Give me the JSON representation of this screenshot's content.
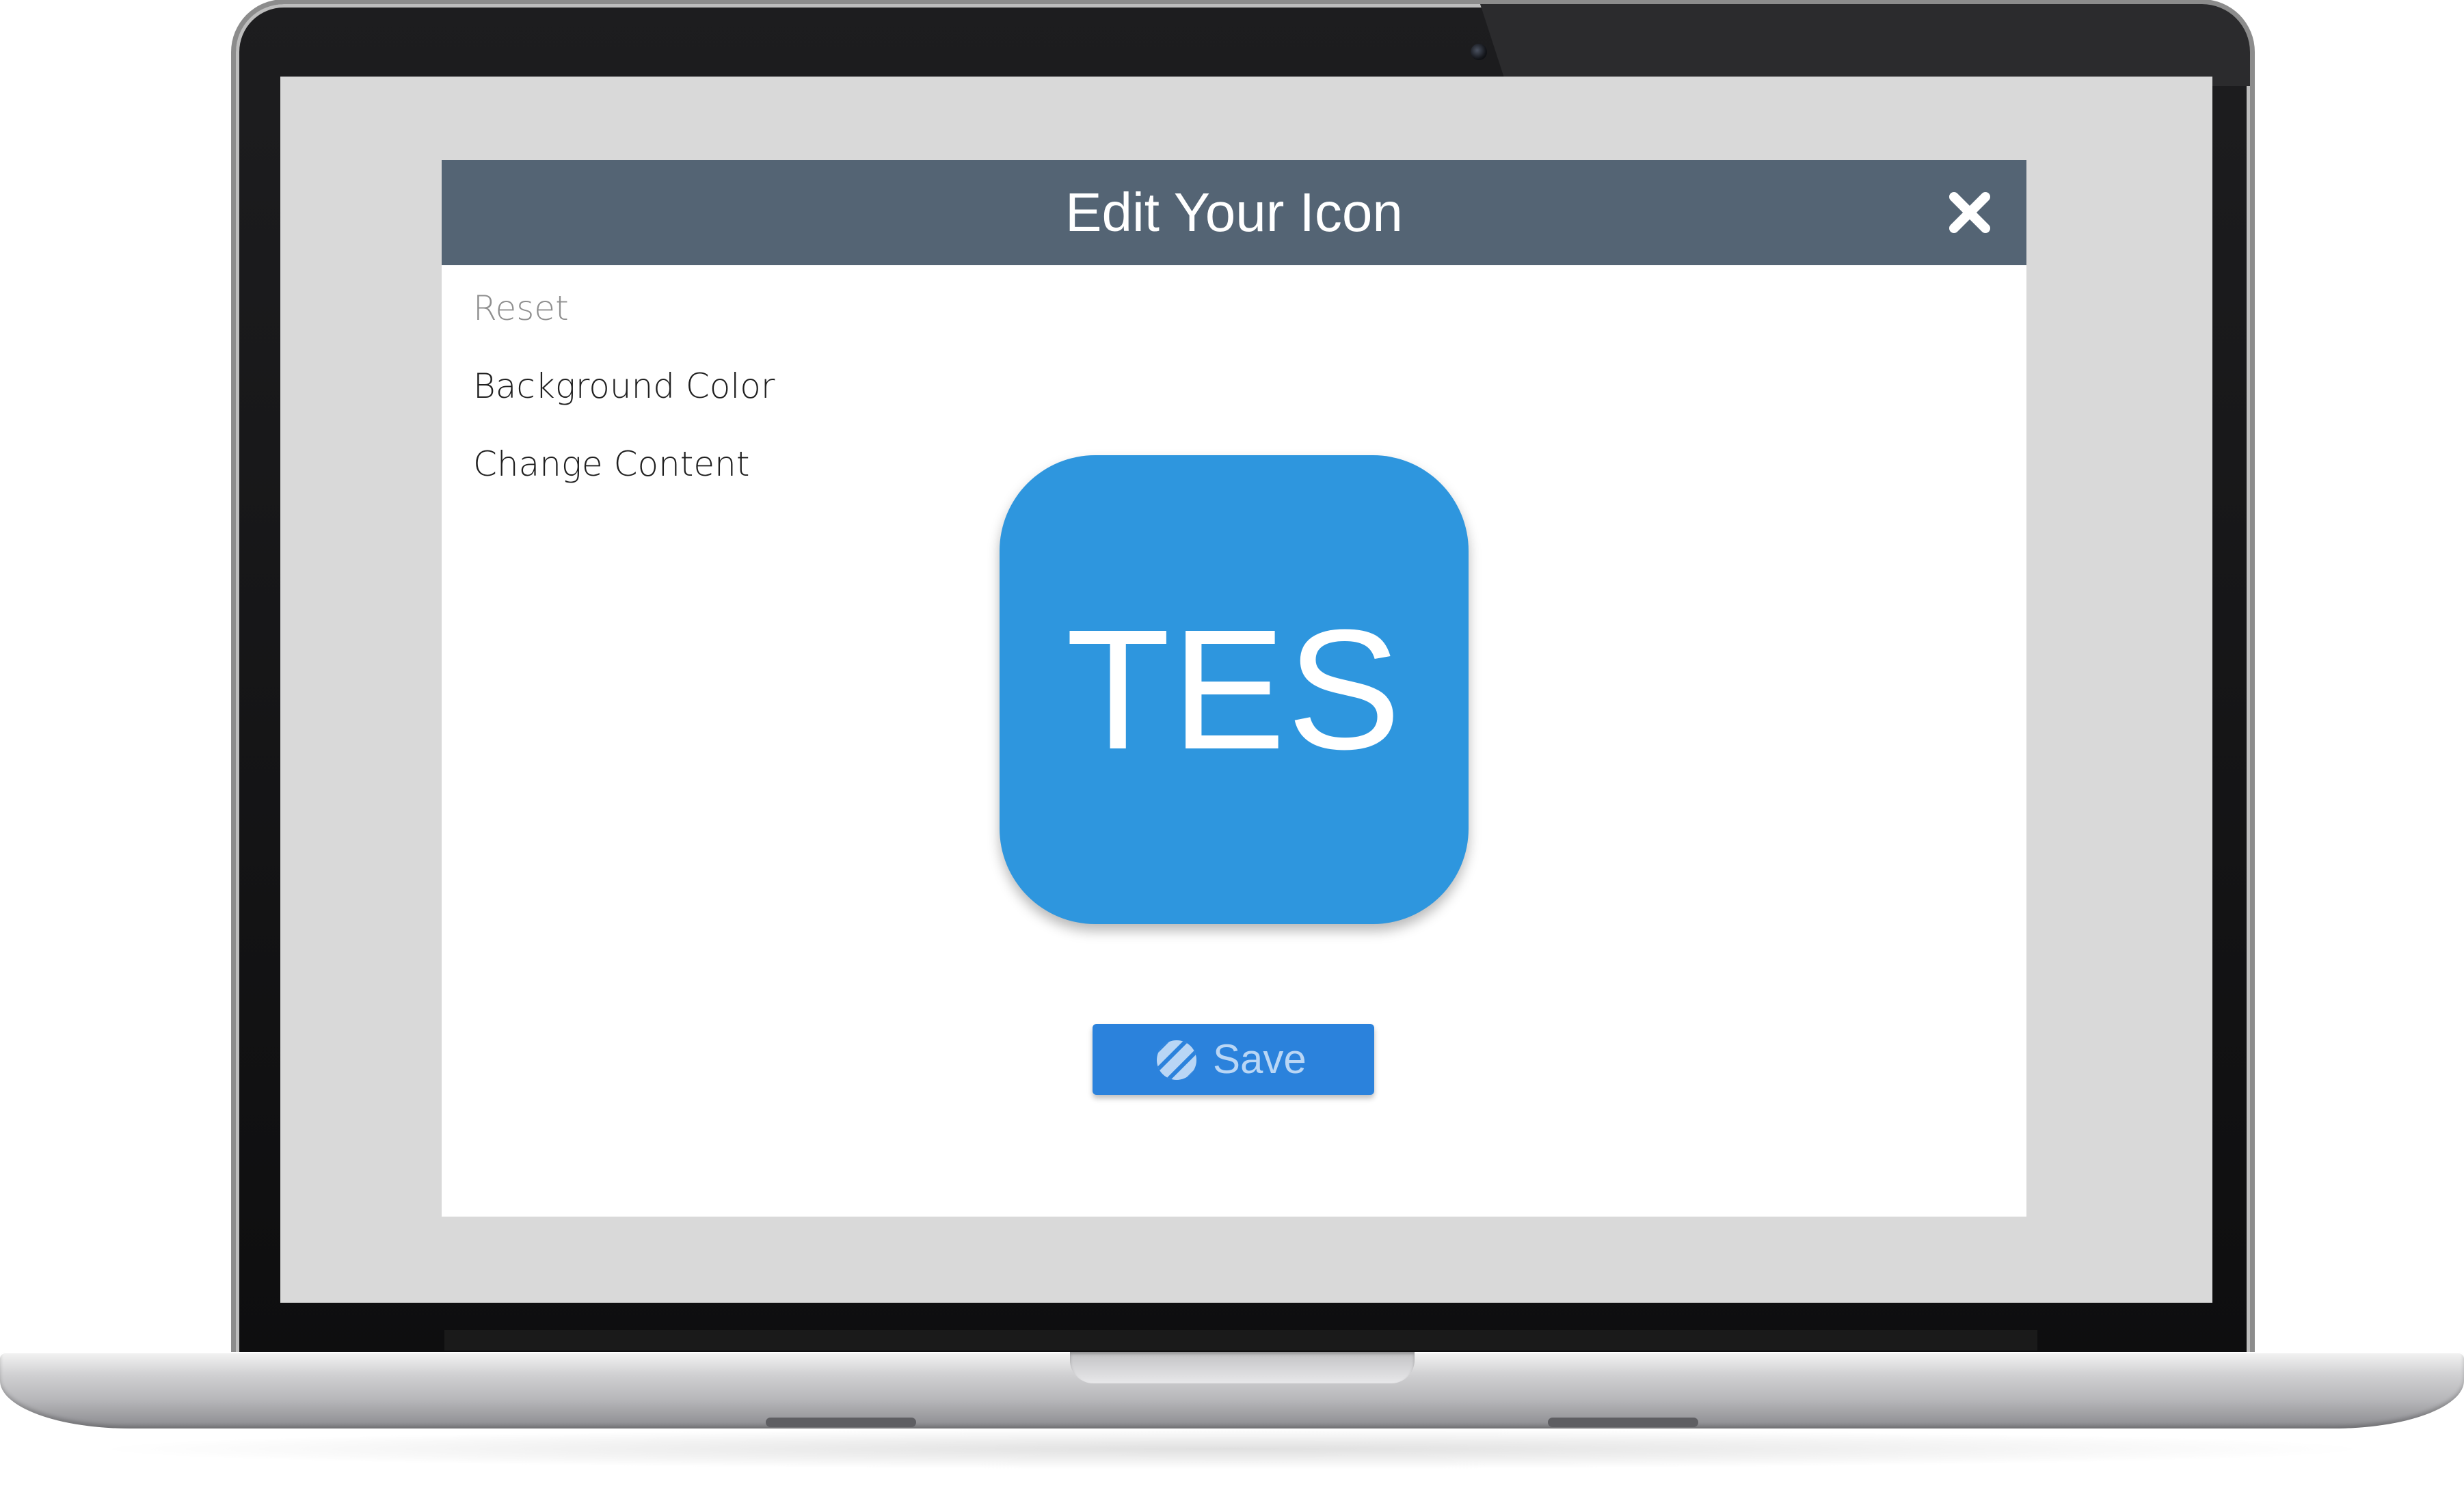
{
  "dialog": {
    "title": "Edit Your Icon",
    "close_icon": "close-icon"
  },
  "menu": {
    "items": [
      {
        "label": "Reset",
        "state": "disabled"
      },
      {
        "label": "Background Color"
      },
      {
        "label": "Change Content"
      }
    ]
  },
  "icon_preview": {
    "text": "TES",
    "background_color": "#2e96de",
    "text_color": "#ffffff"
  },
  "save_button": {
    "label": "Save",
    "icon": "loading-spinner-icon",
    "color": "#2b82dc"
  },
  "colors": {
    "header": "#546474",
    "screen_background": "#d9d9d9"
  }
}
